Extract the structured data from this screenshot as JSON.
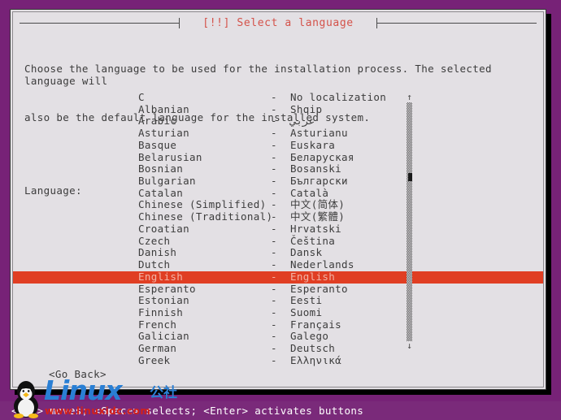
{
  "screen": {
    "background_color": "#772277",
    "dialog_background_color": "#e3e0e4",
    "accent_title_color": "#d4524a",
    "selection_color": "#e03e23",
    "statusbar_color": "#7a2a7a"
  },
  "dialog": {
    "title": "[!!] Select a language",
    "description_line1": "Choose the language to be used for the installation process. The selected language will",
    "description_line2": "also be the default language for the installed system.",
    "field_label": "Language:",
    "go_back_label": "<Go Back>"
  },
  "scrollbar": {
    "up_arrow": "↑",
    "down_arrow": "↓"
  },
  "languages": [
    {
      "name": "C",
      "dash": "-",
      "native": "No localization"
    },
    {
      "name": "Albanian",
      "dash": "-",
      "native": "Shqip"
    },
    {
      "name": "Arabic",
      "dash": "-",
      "native": "عربي"
    },
    {
      "name": "Asturian",
      "dash": "-",
      "native": "Asturianu"
    },
    {
      "name": "Basque",
      "dash": "-",
      "native": "Euskara"
    },
    {
      "name": "Belarusian",
      "dash": "-",
      "native": "Беларуская"
    },
    {
      "name": "Bosnian",
      "dash": "-",
      "native": "Bosanski"
    },
    {
      "name": "Bulgarian",
      "dash": "-",
      "native": "Български"
    },
    {
      "name": "Catalan",
      "dash": "-",
      "native": "Català"
    },
    {
      "name": "Chinese (Simplified)",
      "dash": "-",
      "native": "中文(简体)"
    },
    {
      "name": "Chinese (Traditional)",
      "dash": "-",
      "native": "中文(繁體)"
    },
    {
      "name": "Croatian",
      "dash": "-",
      "native": "Hrvatski"
    },
    {
      "name": "Czech",
      "dash": "-",
      "native": "Čeština"
    },
    {
      "name": "Danish",
      "dash": "-",
      "native": "Dansk"
    },
    {
      "name": "Dutch",
      "dash": "-",
      "native": "Nederlands"
    },
    {
      "name": "English",
      "dash": "-",
      "native": "English",
      "selected": true
    },
    {
      "name": "Esperanto",
      "dash": "-",
      "native": "Esperanto"
    },
    {
      "name": "Estonian",
      "dash": "-",
      "native": "Eesti"
    },
    {
      "name": "Finnish",
      "dash": "-",
      "native": "Suomi"
    },
    {
      "name": "French",
      "dash": "-",
      "native": "Français"
    },
    {
      "name": "Galician",
      "dash": "-",
      "native": "Galego"
    },
    {
      "name": "German",
      "dash": "-",
      "native": "Deutsch"
    },
    {
      "name": "Greek",
      "dash": "-",
      "native": "Ελληνικά"
    }
  ],
  "statusbar": {
    "text": "<Tab> moves; <Space> selects; <Enter> activates buttons"
  },
  "watermark": {
    "brand": "Linux",
    "brand_cn": "公社",
    "url": "www.linuxidc.com"
  }
}
